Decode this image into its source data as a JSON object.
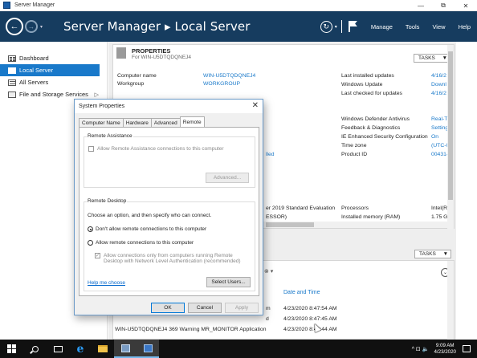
{
  "window": {
    "title": "Server Manager",
    "controls": [
      "—",
      "⧉",
      "✕"
    ]
  },
  "header": {
    "breadcrumb": "Server Manager ▸ Local Server",
    "menu": [
      "Manage",
      "Tools",
      "View",
      "Help"
    ],
    "drop_glyph": "▾"
  },
  "sidebar": {
    "items": [
      {
        "label": "Dashboard",
        "icon": "dashboard-icon"
      },
      {
        "label": "Local Server",
        "icon": "server-icon",
        "active": true
      },
      {
        "label": "All Servers",
        "icon": "servers-icon"
      },
      {
        "label": "File and Storage Services",
        "icon": "storage-icon",
        "chevron": "▷"
      }
    ]
  },
  "properties": {
    "title": "PROPERTIES",
    "subtitle": "For WIN-U5DTQDQNEJ4",
    "tasks_label": "TASKS",
    "left": [
      {
        "label": "Computer name",
        "value": "WIN-U5DTQDQNEJ4"
      },
      {
        "label": "Workgroup",
        "value": "WORKGROUP"
      }
    ],
    "right_top": [
      {
        "label": "Last installed updates",
        "value": "4/16/2"
      },
      {
        "label": "Windows Update",
        "value": "Downl"
      },
      {
        "label": "Last checked for updates",
        "value": "4/16/2"
      }
    ],
    "right_mid": [
      {
        "label": "Windows Defender Antivirus",
        "value": "Real-Ti"
      },
      {
        "label": "Feedback & Diagnostics",
        "value": "Setting"
      },
      {
        "label": "IE Enhanced Security Configuration",
        "value": "On"
      },
      {
        "label": "Time zone",
        "value": "(UTC-0"
      },
      {
        "label": "Product ID",
        "value": "00431-"
      }
    ],
    "partial_enabled": "lled",
    "partial_os": "er 2019 Standard Evaluation",
    "partial_os2": "ESSOR)",
    "processors_label": "Processors",
    "processors_value": "Intel(R",
    "memory_label": "Installed memory (RAM)",
    "memory_value": "1.75 G"
  },
  "events": {
    "tasks_label": "TASKS",
    "col_date": "Date and Time",
    "rows": [
      {
        "left": "m",
        "date": "4/23/2020 8:47:54 AM"
      },
      {
        "left": "d",
        "date": "4/23/2020 8:47:45 AM"
      },
      {
        "left": "WIN-U5DTQDQNEJ4  369  Warning  MR_MONITOR  Application",
        "date": "4/23/2020 8:46:44 AM"
      }
    ],
    "expand_glyph": "⌄",
    "filter_glyph": "⊗ ▾"
  },
  "dialog": {
    "title": "System Properties",
    "close": "✕",
    "tabs": [
      "Computer Name",
      "Hardware",
      "Advanced",
      "Remote"
    ],
    "ra_group": "Remote Assistance",
    "ra_checkbox": "Allow Remote Assistance connections to this computer",
    "advanced_btn": "Advanced...",
    "rd_group": "Remote Desktop",
    "rd_prompt": "Choose an option, and then specify who can connect.",
    "rd_opt1": "Don't allow remote connections to this computer",
    "rd_opt2": "Allow remote connections to this computer",
    "rd_nla_line1": "Allow connections only from computers running Remote",
    "rd_nla_line2": "Desktop with Network Level Authentication (recommended)",
    "help_link": "Help me choose",
    "select_users_btn": "Select Users...",
    "ok": "OK",
    "cancel": "Cancel",
    "apply": "Apply"
  },
  "taskbar": {
    "tray_glyphs": "^ ⊡ 🔈",
    "time": "9:09 AM",
    "date": "4/23/2020"
  }
}
